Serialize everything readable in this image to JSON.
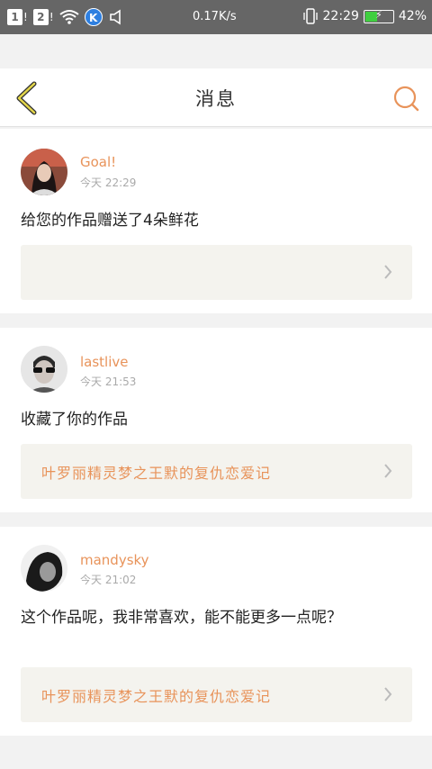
{
  "status_bar": {
    "sim1": "1",
    "sim2": "2",
    "k_badge": "K",
    "speed": "0.17K/s",
    "time": "22:29",
    "battery_percent": "42%",
    "battery_level": 0.42
  },
  "header": {
    "title": "消息"
  },
  "messages": [
    {
      "username": "Goal!",
      "time": "今天 22:29",
      "text": "给您的作品赠送了4朵鲜花",
      "ref": ""
    },
    {
      "username": "lastlive",
      "time": "今天 21:53",
      "text": "收藏了你的作品",
      "ref": "叶罗丽精灵梦之王默的复仇恋爱记"
    },
    {
      "username": "mandysky",
      "time": "今天 21:02",
      "text": "这个作品呢，我非常喜欢，能不能更多一点呢？",
      "ref": "叶罗丽精灵梦之王默的复仇恋爱记"
    }
  ],
  "colors": {
    "accent": "#e8935a",
    "back_arrow": "#e3d64a",
    "status_bar_bg": "#666666",
    "ref_bg": "#f4f3ee"
  }
}
